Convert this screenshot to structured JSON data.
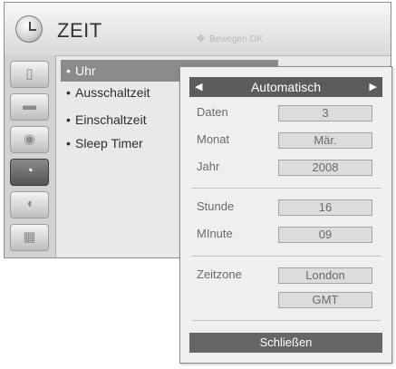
{
  "header": {
    "title": "ZEIT",
    "hint_icon": "dpad-move-icon",
    "hint_text": "Bewegen  OK"
  },
  "sidebar": {
    "items": [
      {
        "name": "picture-icon",
        "glyph": "▯"
      },
      {
        "name": "audio-icon",
        "glyph": "▬"
      },
      {
        "name": "setup-icon",
        "glyph": "◉"
      },
      {
        "name": "time-icon",
        "glyph": "◔"
      },
      {
        "name": "lock-icon",
        "glyph": "◖"
      },
      {
        "name": "option-icon",
        "glyph": "▦"
      }
    ],
    "active_index": 3
  },
  "menu": {
    "items": [
      {
        "label": "Uhr"
      },
      {
        "label": "Ausschaltzeit"
      },
      {
        "label": "Einschaltzeit"
      },
      {
        "label": "Sleep Timer"
      }
    ],
    "selected_index": 0
  },
  "popup": {
    "mode": "Automatisch",
    "fields": {
      "daten": {
        "label": "Daten",
        "value": "3"
      },
      "monat": {
        "label": "Monat",
        "value": "Mär."
      },
      "jahr": {
        "label": "Jahr",
        "value": "2008"
      },
      "stunde": {
        "label": "Stunde",
        "value": "16"
      },
      "minute": {
        "label": "MInute",
        "value": "09"
      },
      "zeitzone": {
        "label": "Zeitzone",
        "value": "London",
        "value2": "GMT"
      }
    },
    "close_label": "Schließen"
  },
  "colors": {
    "highlight": "#8b8b8b",
    "mode_bar": "#5c5c5c",
    "button": "#666666"
  }
}
